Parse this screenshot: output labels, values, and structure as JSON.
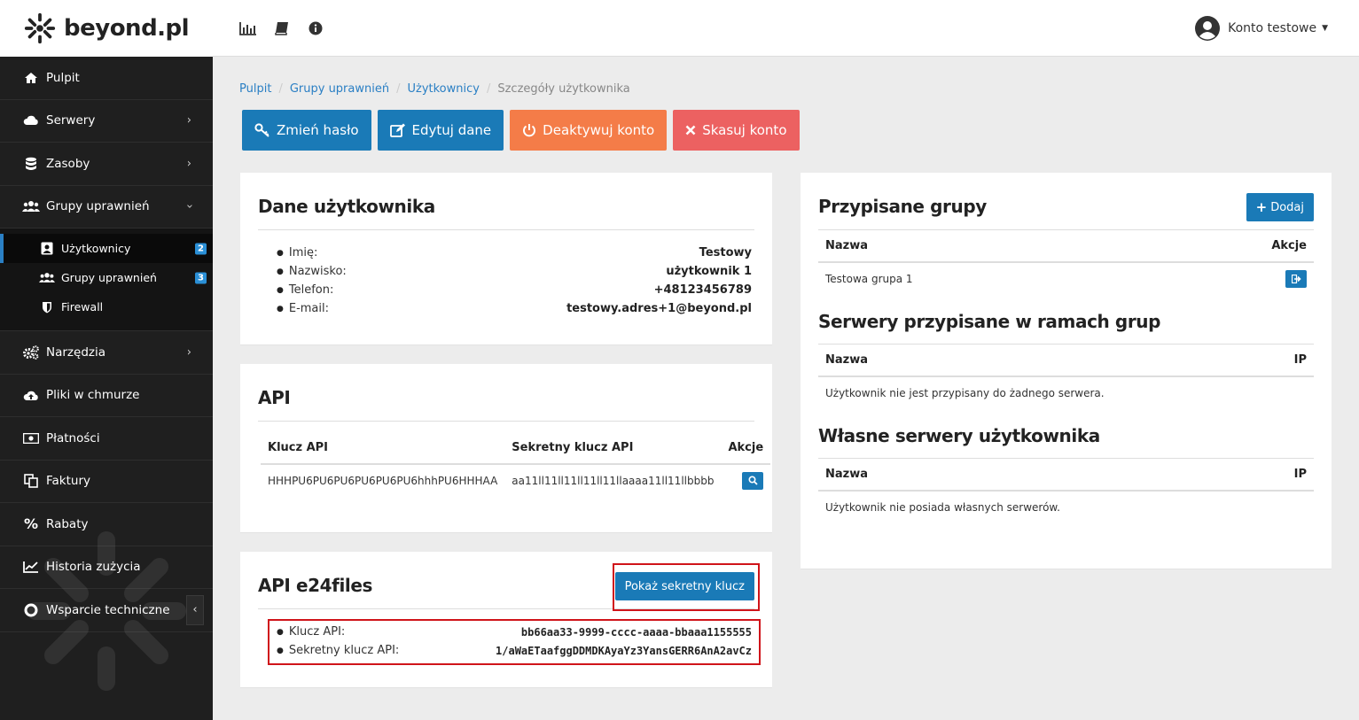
{
  "brand": {
    "name": "beyond.pl"
  },
  "sidebar": {
    "items": [
      {
        "label": "Pulpit",
        "icon": "home-icon"
      },
      {
        "label": "Serwery",
        "icon": "cloud-icon"
      },
      {
        "label": "Zasoby",
        "icon": "database-icon"
      },
      {
        "label": "Grupy uprawnień",
        "icon": "users-icon"
      },
      {
        "label": "Narzędzia",
        "icon": "cogs-icon"
      },
      {
        "label": "Pliki w chmurze",
        "icon": "cloud-upload-icon"
      },
      {
        "label": "Płatności",
        "icon": "money-icon"
      },
      {
        "label": "Faktury",
        "icon": "copy-icon"
      },
      {
        "label": "Rabaty",
        "icon": "percent-icon"
      },
      {
        "label": "Historia zużycia",
        "icon": "chart-line-icon"
      },
      {
        "label": "Wsparcie techniczne",
        "icon": "life-ring-icon"
      }
    ],
    "subitems": [
      {
        "label": "Użytkownicy",
        "badge": "2",
        "icon": "user-card-icon"
      },
      {
        "label": "Grupy uprawnień",
        "badge": "3",
        "icon": "users-icon"
      },
      {
        "label": "Firewall",
        "icon": "shield-icon"
      }
    ]
  },
  "topbar": {
    "icons": [
      "bar-chart-icon",
      "book-icon",
      "info-icon"
    ],
    "account_label": "Konto testowe"
  },
  "breadcrumb": {
    "items": [
      "Pulpit",
      "Grupy uprawnień",
      "Użytkownicy"
    ],
    "current": "Szczegóły użytkownika"
  },
  "actions": {
    "change_password": "Zmień hasło",
    "edit": "Edytuj dane",
    "deactivate": "Deaktywuj konto",
    "delete": "Skasuj konto"
  },
  "colors": {
    "primary": "#1a7ab7",
    "warning": "#f47c48",
    "danger": "#ec6161",
    "highlight": "#d0141a",
    "sidebar": "#1f1f1f"
  },
  "user": {
    "title": "Dane użytkownika",
    "fields": [
      {
        "key": "Imię:",
        "value": "Testowy"
      },
      {
        "key": "Nazwisko:",
        "value": "użytkownik 1"
      },
      {
        "key": "Telefon:",
        "value": "+48123456789"
      },
      {
        "key": "E-mail:",
        "value": "testowy.adres+1@beyond.pl"
      }
    ]
  },
  "api": {
    "title": "API",
    "headers": [
      "Klucz API",
      "Sekretny klucz API",
      "Akcje"
    ],
    "rows": [
      {
        "key": "HHHPU6PU6PU6PU6PU6PU6hhhPU6HHHAA",
        "secret": "aa11ll11ll11ll11ll11llaaaa11ll11llbbbb"
      }
    ]
  },
  "e24": {
    "title": "API e24files",
    "show_secret_label": "Pokaż sekretny klucz",
    "fields": [
      {
        "key": "Klucz API:",
        "value": "bb66aa33-9999-cccc-aaaa-bbaaa1155555"
      },
      {
        "key": "Sekretny klucz API:",
        "value": "1/aWaETaafggDDMDKAyaYz3YansGERR6AnA2avCz"
      }
    ]
  },
  "groups": {
    "title": "Przypisane grupy",
    "add_label": "Dodaj",
    "headers": [
      "Nazwa",
      "Akcje"
    ],
    "rows": [
      {
        "name": "Testowa grupa 1"
      }
    ]
  },
  "group_servers": {
    "title": "Serwery przypisane w ramach grup",
    "headers": [
      "Nazwa",
      "IP"
    ],
    "empty": "Użytkownik nie jest przypisany do żadnego serwera."
  },
  "own_servers": {
    "title": "Własne serwery użytkownika",
    "headers": [
      "Nazwa",
      "IP"
    ],
    "empty": "Użytkownik nie posiada własnych serwerów."
  }
}
